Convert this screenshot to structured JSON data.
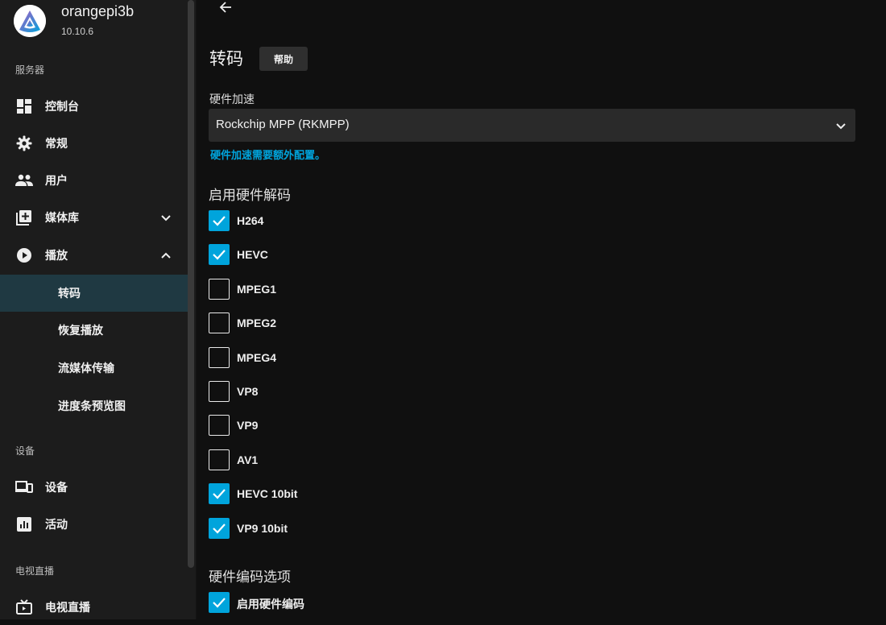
{
  "server": {
    "name": "orangepi3b",
    "version": "10.10.6"
  },
  "sidebar": {
    "section_server": "服务器",
    "items": [
      {
        "label": "控制台"
      },
      {
        "label": "常规"
      },
      {
        "label": "用户"
      },
      {
        "label": "媒体库"
      },
      {
        "label": "播放"
      }
    ],
    "playback_sub": [
      {
        "label": "转码"
      },
      {
        "label": "恢复播放"
      },
      {
        "label": "流媒体传输"
      },
      {
        "label": "进度条预览图"
      }
    ],
    "section_devices": "设备",
    "device_items": [
      {
        "label": "设备"
      },
      {
        "label": "活动"
      }
    ],
    "section_livetv": "电视直播",
    "livetv_items": [
      {
        "label": "电视直播"
      }
    ]
  },
  "main": {
    "title": "转码",
    "help_label": "帮助",
    "hw_accel_label": "硬件加速",
    "hw_accel_value": "Rockchip MPP (RKMPP)",
    "hw_accel_hint": "硬件加速需要额外配置。",
    "decode_heading": "启用硬件解码",
    "codecs": [
      {
        "label": "H264",
        "checked": true
      },
      {
        "label": "HEVC",
        "checked": true
      },
      {
        "label": "MPEG1",
        "checked": false
      },
      {
        "label": "MPEG2",
        "checked": false
      },
      {
        "label": "MPEG4",
        "checked": false
      },
      {
        "label": "VP8",
        "checked": false
      },
      {
        "label": "VP9",
        "checked": false
      },
      {
        "label": "AV1",
        "checked": false
      },
      {
        "label": "HEVC 10bit",
        "checked": true
      },
      {
        "label": "VP9 10bit",
        "checked": true
      }
    ],
    "encode_heading": "硬件编码选项",
    "encode_options": [
      {
        "label": "启用硬件编码",
        "checked": true
      }
    ]
  },
  "colors": {
    "accent": "#00a4dc",
    "active_bg": "#1f3942",
    "sidebar_bg": "#1c1c1c",
    "main_bg": "#101010"
  }
}
